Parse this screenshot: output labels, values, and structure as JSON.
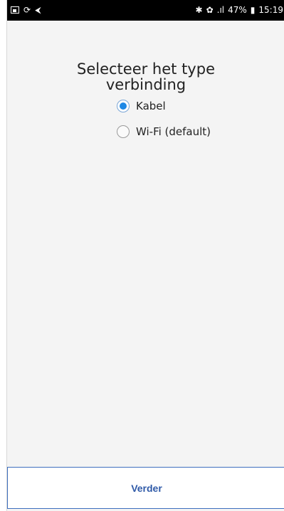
{
  "status_bar": {
    "battery_percent": "47%",
    "time": "15:19",
    "icons_left": [
      "gallery-icon",
      "sync-icon",
      "send-icon"
    ],
    "icons_right": [
      "bluetooth-icon",
      "mute-icon",
      "signal-icon",
      "battery-icon"
    ],
    "signal_text": ".ıl"
  },
  "main": {
    "title": "Selecteer het type verbinding",
    "options": [
      {
        "label": "Kabel",
        "selected": true
      },
      {
        "label": "Wi-Fi (default)",
        "selected": false
      }
    ]
  },
  "footer": {
    "next_label": "Verder"
  },
  "colors": {
    "accent": "#1e88e5",
    "button_text": "#2f5aa8",
    "button_border": "#3e6fbe",
    "background": "#f4f4f4"
  }
}
